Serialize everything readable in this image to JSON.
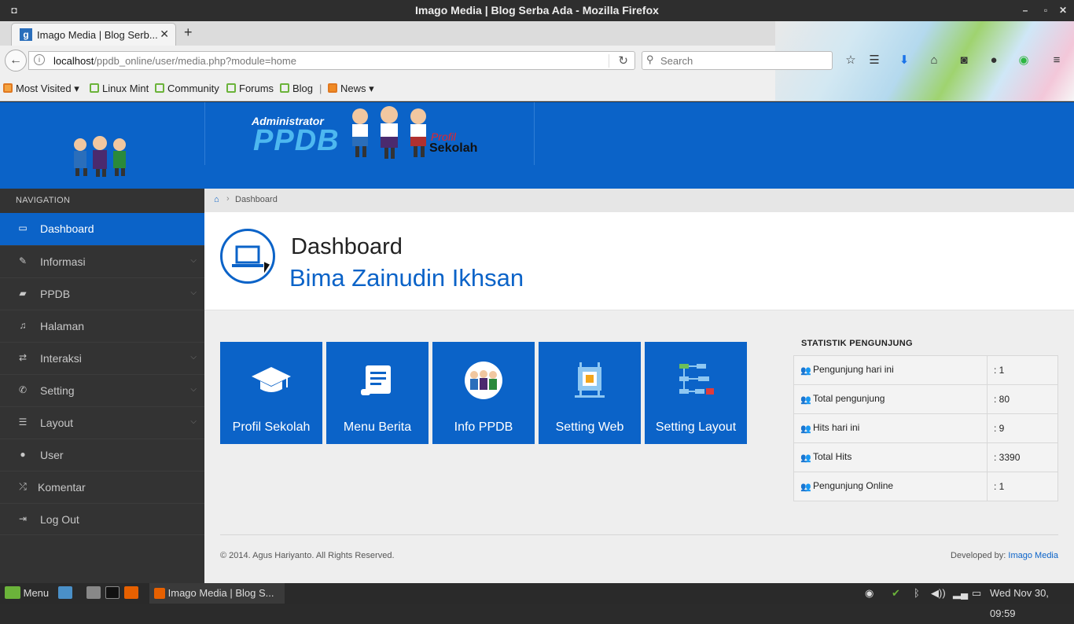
{
  "window": {
    "title": "Imago Media | Blog Serba Ada - Mozilla Firefox"
  },
  "browser": {
    "tab_title": "Imago Media | Blog Serb...",
    "favicon_letter": "g",
    "url_host": "localhost",
    "url_path": "/ppdb_online/user/media.php?module=home",
    "search_placeholder": "Search"
  },
  "bookmarks": [
    {
      "label": "Most Visited",
      "icon": "folder-icon"
    },
    {
      "label": "Linux Mint",
      "icon": "mint-icon"
    },
    {
      "label": "Community",
      "icon": "mint-icon"
    },
    {
      "label": "Forums",
      "icon": "mint-icon"
    },
    {
      "label": "Blog",
      "icon": "mint-icon"
    },
    {
      "label": "News",
      "icon": "rss-icon"
    }
  ],
  "header": {
    "banner_admin": "Administrator",
    "banner_ppdb": "PPDB",
    "banner_profil": "Profil",
    "banner_sekolah": "Sekolah"
  },
  "sidebar": {
    "heading": "NAVIGATION",
    "items": [
      {
        "label": "Dashboard",
        "icon": "laptop-icon",
        "active": true,
        "has_children": false
      },
      {
        "label": "Informasi",
        "icon": "pencil-icon",
        "active": false,
        "has_children": true
      },
      {
        "label": "PPDB",
        "icon": "book-icon",
        "active": false,
        "has_children": true
      },
      {
        "label": "Halaman",
        "icon": "bell-icon",
        "active": false,
        "has_children": false
      },
      {
        "label": "Interaksi",
        "icon": "exchange-icon",
        "active": false,
        "has_children": true
      },
      {
        "label": "Setting",
        "icon": "wrench-icon",
        "active": false,
        "has_children": true
      },
      {
        "label": "Layout",
        "icon": "list-icon",
        "active": false,
        "has_children": true
      },
      {
        "label": "User",
        "icon": "user-icon",
        "active": false,
        "has_children": false
      },
      {
        "label": "Komentar",
        "icon": "shuffle-icon",
        "active": false,
        "has_children": false
      },
      {
        "label": "Log Out",
        "icon": "logout-icon",
        "active": false,
        "has_children": false
      }
    ]
  },
  "breadcrumb": {
    "current": "Dashboard"
  },
  "page": {
    "title": "Dashboard",
    "subtitle": "Bima Zainudin Ikhsan"
  },
  "tiles": [
    {
      "label": "Profil Sekolah",
      "icon": "graduation-cap-icon"
    },
    {
      "label": "Menu Berita",
      "icon": "scroll-icon"
    },
    {
      "label": "Info PPDB",
      "icon": "students-icon"
    },
    {
      "label": "Setting Web",
      "icon": "chip-icon"
    },
    {
      "label": "Setting Layout",
      "icon": "flowchart-icon"
    }
  ],
  "stats": {
    "title": "STATISTIK PENGUNJUNG",
    "rows": [
      {
        "label": "Pengunjung hari ini",
        "value": ": 1"
      },
      {
        "label": "Total pengunjung",
        "value": ": 80"
      },
      {
        "label": "Hits hari ini",
        "value": ": 9"
      },
      {
        "label": "Total Hits",
        "value": ": 3390"
      },
      {
        "label": "Pengunjung Online",
        "value": ": 1"
      }
    ]
  },
  "footer": {
    "copyright": "© 2014. Agus Hariyanto. All Rights Reserved.",
    "developed_by": "Developed by:",
    "developer": "Imago Media"
  },
  "taskbar": {
    "menu_label": "Menu",
    "window_label": "Imago Media | Blog S...",
    "clock": "Wed Nov 30, 09:59"
  },
  "colors": {
    "brand": "#0b63c8",
    "sidebar": "#333333"
  }
}
